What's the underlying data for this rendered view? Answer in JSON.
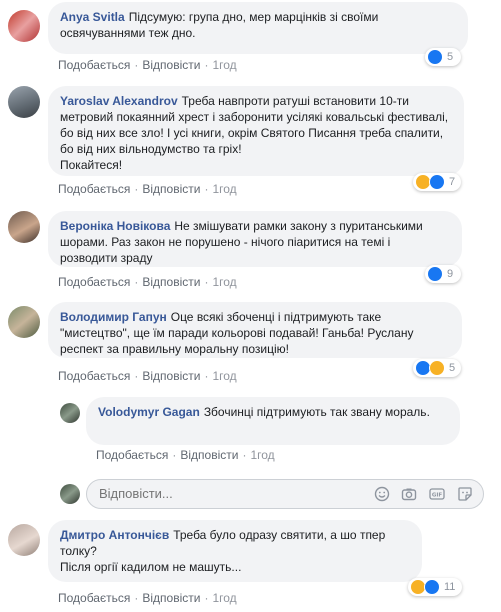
{
  "comments": [
    {
      "author": "Anya Svitla",
      "text": "Підсумую: група дно, мер марцінків зі своїми освячуваннями теж дно.",
      "like_label": "Подобається",
      "reply_label": "Відповісти",
      "time": "1год",
      "reaction_count": "5",
      "reactions": [
        "like"
      ]
    },
    {
      "author": "Yaroslav Alexandrov",
      "text": "Треба навпроти ратуші встановити 10-ти метровий покаянний хрест і заборонити усілякі ковальські фестивалі, бо від них все зло! І усі книги, окрім Святого Писання треба спалити, бо від них вільнодумство та гріх!\nПокайтеся!",
      "like_label": "Подобається",
      "reply_label": "Відповісти",
      "time": "1год",
      "reaction_count": "7",
      "reactions": [
        "haha",
        "like"
      ]
    },
    {
      "author": "Вероніка Новікова",
      "text": "Не змішувати рамки закону з пуританськими шорами. Раз закон не порушено - нічого піаритися на темі і розводити зраду",
      "like_label": "Подобається",
      "reply_label": "Відповісти",
      "time": "1год",
      "reaction_count": "9",
      "reactions": [
        "like"
      ]
    },
    {
      "author": "Володимир Гапун",
      "text": "Оце всякі збоченці і підтримують таке \"мистецтво\", ще їм паради кольорові подавай! Ганьба! Руслану респект за правильну моральну позицію!",
      "like_label": "Подобається",
      "reply_label": "Відповісти",
      "time": "1год",
      "reaction_count": "5",
      "reactions": [
        "like",
        "haha"
      ]
    },
    {
      "author": "Volodymyr Gagan",
      "text": "Збочинці підтримують так звану мораль.",
      "like_label": "Подобається",
      "reply_label": "Відповісти",
      "time": "1год"
    },
    {
      "author": "Дмитро Антончієв",
      "text": "Треба було одразу святити, а шо тпер толку?\nПісля оргії кадилом не машуть...",
      "like_label": "Подобається",
      "reply_label": "Відповісти",
      "time": "1год",
      "reaction_count": "11",
      "reactions": [
        "haha",
        "like"
      ]
    }
  ],
  "reply_box": {
    "placeholder": "Відповісти...",
    "icons": [
      "emoji-icon",
      "camera-icon",
      "gif-icon",
      "sticker-icon"
    ]
  },
  "colors": {
    "author": "#385898",
    "bubble": "#f2f3f5",
    "meta": "#606770",
    "like": "#1877f2",
    "haha": "#f7b125"
  }
}
